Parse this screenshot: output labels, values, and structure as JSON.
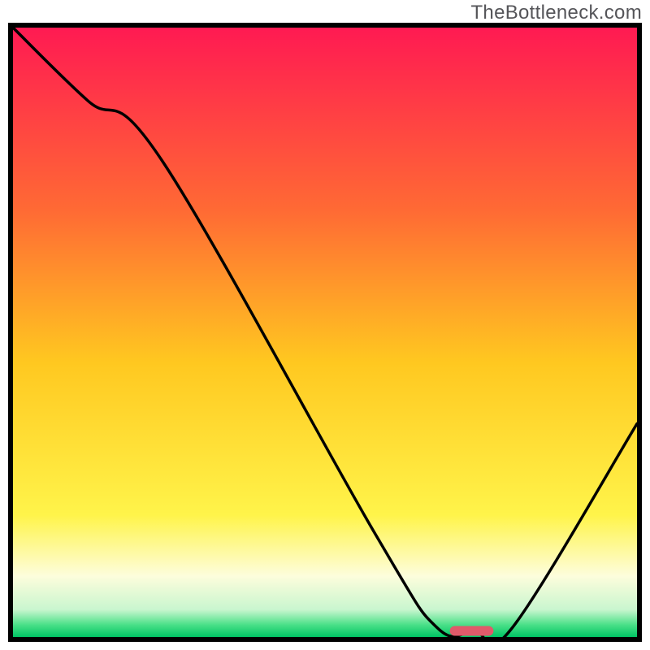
{
  "watermark": "TheBottleneck.com",
  "chart_data": {
    "type": "line",
    "title": "",
    "xlabel": "",
    "ylabel": "",
    "xlim": [
      0,
      100
    ],
    "ylim": [
      0,
      100
    ],
    "legend": false,
    "grid": false,
    "background": {
      "gradient_stops": [
        {
          "pos": 0.0,
          "color": "#ff1a52"
        },
        {
          "pos": 0.3,
          "color": "#ff6a34"
        },
        {
          "pos": 0.55,
          "color": "#ffc820"
        },
        {
          "pos": 0.8,
          "color": "#fff44a"
        },
        {
          "pos": 0.9,
          "color": "#fdfddc"
        },
        {
          "pos": 0.955,
          "color": "#c9f6cf"
        },
        {
          "pos": 0.98,
          "color": "#4ae088"
        },
        {
          "pos": 1.0,
          "color": "#00c464"
        }
      ]
    },
    "series": [
      {
        "name": "curve",
        "x": [
          0,
          12,
          24,
          58,
          68,
          74,
          80,
          100
        ],
        "y": [
          100,
          88,
          78,
          17,
          1.5,
          1.0,
          1.5,
          35
        ]
      }
    ],
    "marker": {
      "x_start": 70,
      "x_end": 77,
      "y": 1.0,
      "color": "#e05a6a"
    }
  }
}
